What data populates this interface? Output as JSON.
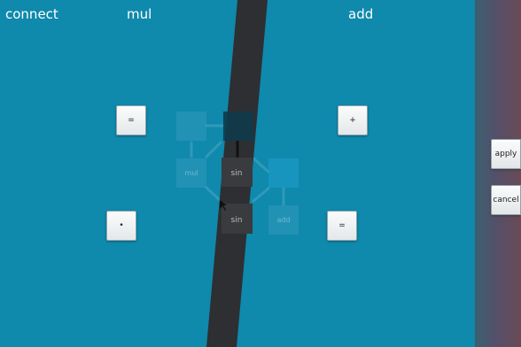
{
  "header": {
    "connect_label": "connect",
    "mul_label": "mul",
    "add_label": "add"
  },
  "operators": {
    "equals_top": "=",
    "plus": "+",
    "dot": "•",
    "equals_bottom": "="
  },
  "graph": {
    "node_sin_top": "sin",
    "node_sin_bottom": "sin",
    "ghost_nodes": [
      "mul",
      "add"
    ]
  },
  "sidebar": {
    "apply_label": "apply",
    "cancel_label": "cancel"
  },
  "colors": {
    "background": "#0f89ac",
    "band": "#2d2f33",
    "node": "#3a3b3e",
    "selected_node": "#0e3b4a"
  }
}
